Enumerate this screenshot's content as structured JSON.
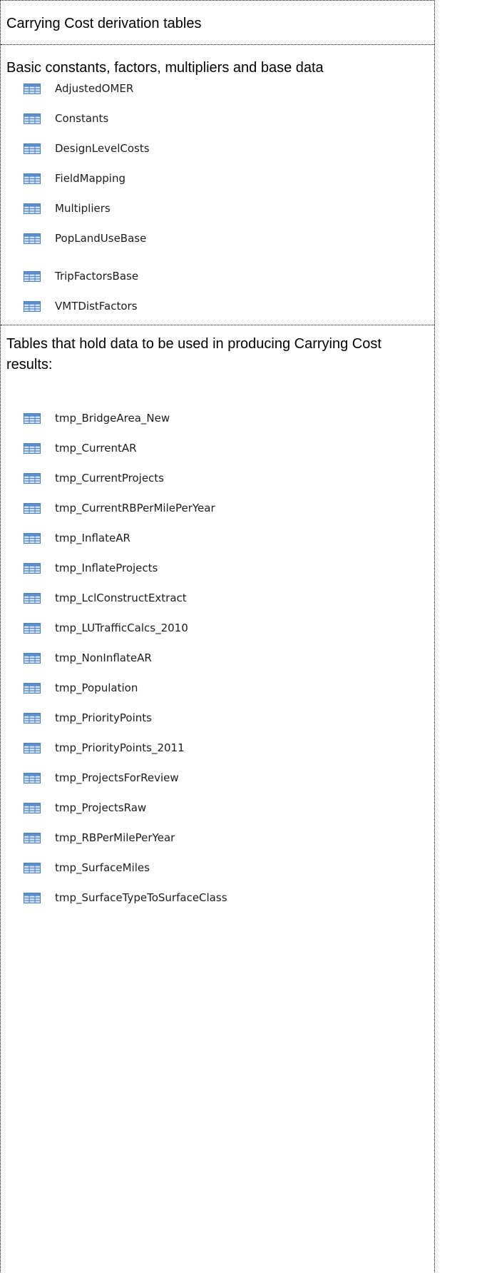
{
  "title": "Carrying Cost derivation tables",
  "base_section": {
    "heading": "Basic constants, factors, multipliers and base data",
    "items": [
      {
        "label": "AdjustedOMER",
        "icon": "table-icon"
      },
      {
        "label": "Constants",
        "icon": "table-icon"
      },
      {
        "label": "DesignLevelCosts",
        "icon": "table-icon"
      },
      {
        "label": "FieldMapping",
        "icon": "table-icon"
      },
      {
        "label": "Multipliers",
        "icon": "table-icon"
      },
      {
        "label": "PopLandUseBase",
        "icon": "table-icon"
      },
      {
        "label": "TripFactorsBase",
        "icon": "table-icon"
      },
      {
        "label": "VMTDistFactors",
        "icon": "table-icon"
      }
    ]
  },
  "tmp_section": {
    "heading": "Tables that hold data to be used in producing Carrying Cost results:",
    "items": [
      {
        "label": "tmp_BridgeArea_New",
        "icon": "table-icon"
      },
      {
        "label": "tmp_CurrentAR",
        "icon": "table-icon"
      },
      {
        "label": "tmp_CurrentProjects",
        "icon": "table-icon"
      },
      {
        "label": "tmp_CurrentRBPerMilePerYear",
        "icon": "table-icon"
      },
      {
        "label": "tmp_InflateAR",
        "icon": "table-icon"
      },
      {
        "label": "tmp_InflateProjects",
        "icon": "table-icon"
      },
      {
        "label": "tmp_LclConstructExtract",
        "icon": "table-icon"
      },
      {
        "label": "tmp_LUTrafficCalcs_2010",
        "icon": "table-icon"
      },
      {
        "label": "tmp_NonInflateAR",
        "icon": "table-icon"
      },
      {
        "label": "tmp_Population",
        "icon": "table-icon"
      },
      {
        "label": "tmp_PriorityPoints",
        "icon": "table-icon"
      },
      {
        "label": "tmp_PriorityPoints_2011",
        "icon": "table-icon"
      },
      {
        "label": "tmp_ProjectsForReview",
        "icon": "table-icon"
      },
      {
        "label": "tmp_ProjectsRaw",
        "icon": "table-icon"
      },
      {
        "label": "tmp_RBPerMilePerYear",
        "icon": "table-icon"
      },
      {
        "label": "tmp_SurfaceMiles",
        "icon": "table-icon"
      },
      {
        "label": "tmp_SurfaceTypeToSurfaceClass",
        "icon": "table-icon"
      }
    ]
  }
}
